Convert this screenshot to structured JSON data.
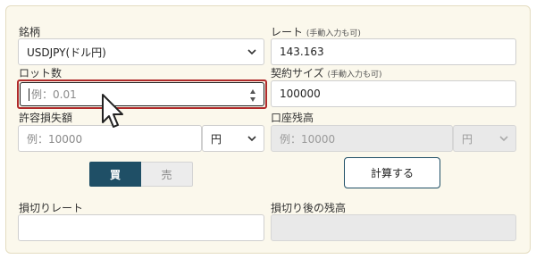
{
  "currency_pair": {
    "label": "銘柄",
    "value": "USDJPY(ドル円)"
  },
  "rate": {
    "label": "レート",
    "note": "(手動入力も可)",
    "value": "143.163"
  },
  "lot": {
    "label": "ロット数",
    "placeholder": "例：0.01"
  },
  "contract_size": {
    "label": "契約サイズ",
    "note": "(手動入力も可)",
    "value": "100000"
  },
  "allowable_loss": {
    "label": "許容損失額",
    "placeholder": "例：10000",
    "unit": "円"
  },
  "account_balance": {
    "label": "口座残高",
    "placeholder": "例：10000",
    "unit": "円"
  },
  "side": {
    "buy_label": "買",
    "sell_label": "売",
    "selected": "buy"
  },
  "calculate_button": {
    "label": "計算する"
  },
  "stop_loss_rate": {
    "label": "損切りレート",
    "value": ""
  },
  "balance_after_stop": {
    "label": "損切り後の残高",
    "value": ""
  },
  "colors": {
    "panel_bg": "#fbf8ec",
    "accent": "#1f4f66",
    "focus_outline": "#b02a2a"
  }
}
